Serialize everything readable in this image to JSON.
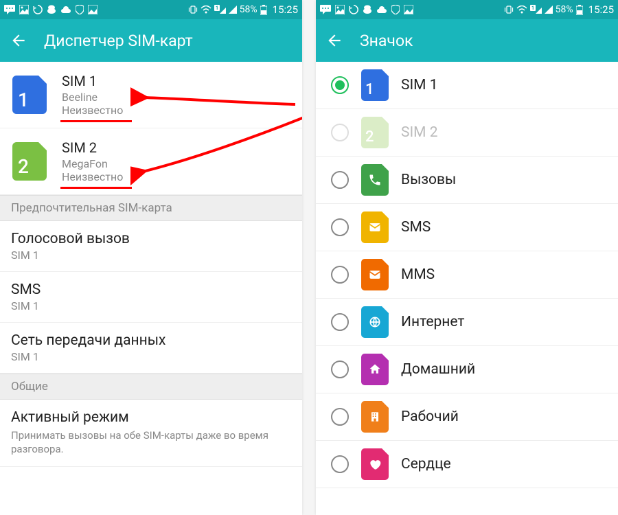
{
  "status": {
    "battery": "58%",
    "time": "15:25"
  },
  "left": {
    "title": "Диспетчер SIM-карт",
    "sim1": {
      "label": "SIM 1",
      "carrier": "Beeline",
      "state": "Неизвестно",
      "num": "1",
      "color": "#2f6fe0"
    },
    "sim2": {
      "label": "SIM 2",
      "carrier": "MegaFon",
      "state": "Неизвестно",
      "num": "2",
      "color": "#7bc043"
    },
    "section1": "Предпочтительная SIM-карта",
    "voice": {
      "title": "Голосовой вызов",
      "value": "SIM 1"
    },
    "sms": {
      "title": "SMS",
      "value": "SIM 1"
    },
    "data": {
      "title": "Сеть передачи данных",
      "value": "SIM 1"
    },
    "section2": "Общие",
    "active": {
      "title": "Активный режим",
      "desc": "Принимать вызовы на обе SIM-карты даже во время разговора."
    }
  },
  "right": {
    "title": "Значок",
    "items": [
      {
        "label": "SIM 1",
        "color": "#2f6fe0",
        "selected": true,
        "num": "1"
      },
      {
        "label": "SIM 2",
        "color": "#bfe09a",
        "disabled": true,
        "num": "2"
      },
      {
        "label": "Вызовы",
        "color": "#3fa24a",
        "icon": "phone"
      },
      {
        "label": "SMS",
        "color": "#f0b400",
        "icon": "sms"
      },
      {
        "label": "MMS",
        "color": "#f06a00",
        "icon": "mms"
      },
      {
        "label": "Интернет",
        "color": "#17a7d4",
        "icon": "globe"
      },
      {
        "label": "Домашний",
        "color": "#b42fb0",
        "icon": "home"
      },
      {
        "label": "Рабочий",
        "color": "#f07f1a",
        "icon": "work"
      },
      {
        "label": "Сердце",
        "color": "#e22b72",
        "icon": "heart"
      }
    ]
  }
}
